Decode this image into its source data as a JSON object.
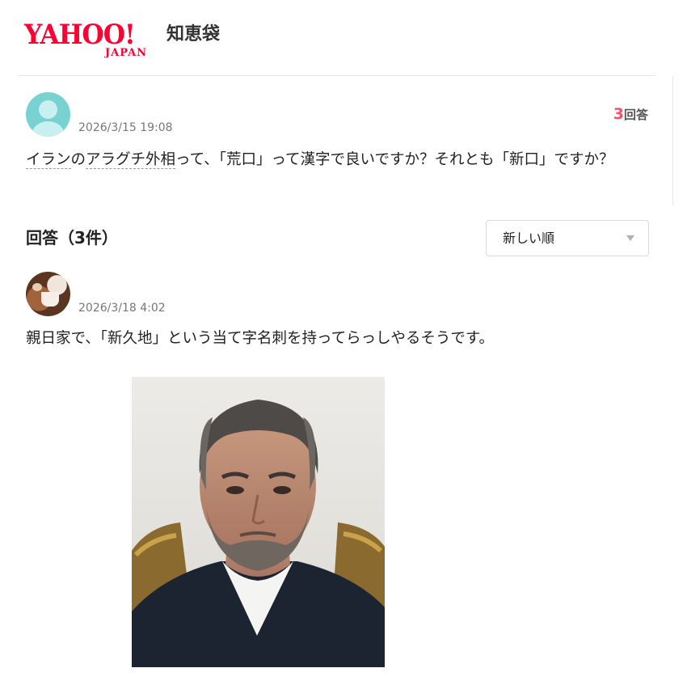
{
  "header": {
    "logo_text": "YAHOO!",
    "logo_sub": "JAPAN",
    "service_name": "知恵袋"
  },
  "question": {
    "date": "2026/3/15 19:08",
    "answer_count": "3",
    "answer_count_unit": "回答",
    "text_parts": {
      "keyword_1": "イラン",
      "connector": "の",
      "keyword_2": "アラグチ外相",
      "rest": "って、「荒口」って漢字で良いですか？それとも「新口」ですか？"
    }
  },
  "answers_section": {
    "heading": "回答（3件）",
    "sort_label": "新しい順"
  },
  "answer": {
    "date": "2026/3/18 4:02",
    "text": "親日家で、「新久地」という当て字名刺を持ってらっしやるそうです。"
  },
  "colors": {
    "brand": "#ff0033",
    "count_accent": "#ff4d66",
    "default_avatar": "#79d2d2"
  },
  "icons": {
    "user_avatar": "user-avatar-icon",
    "sort_caret": "caret-down-icon"
  }
}
